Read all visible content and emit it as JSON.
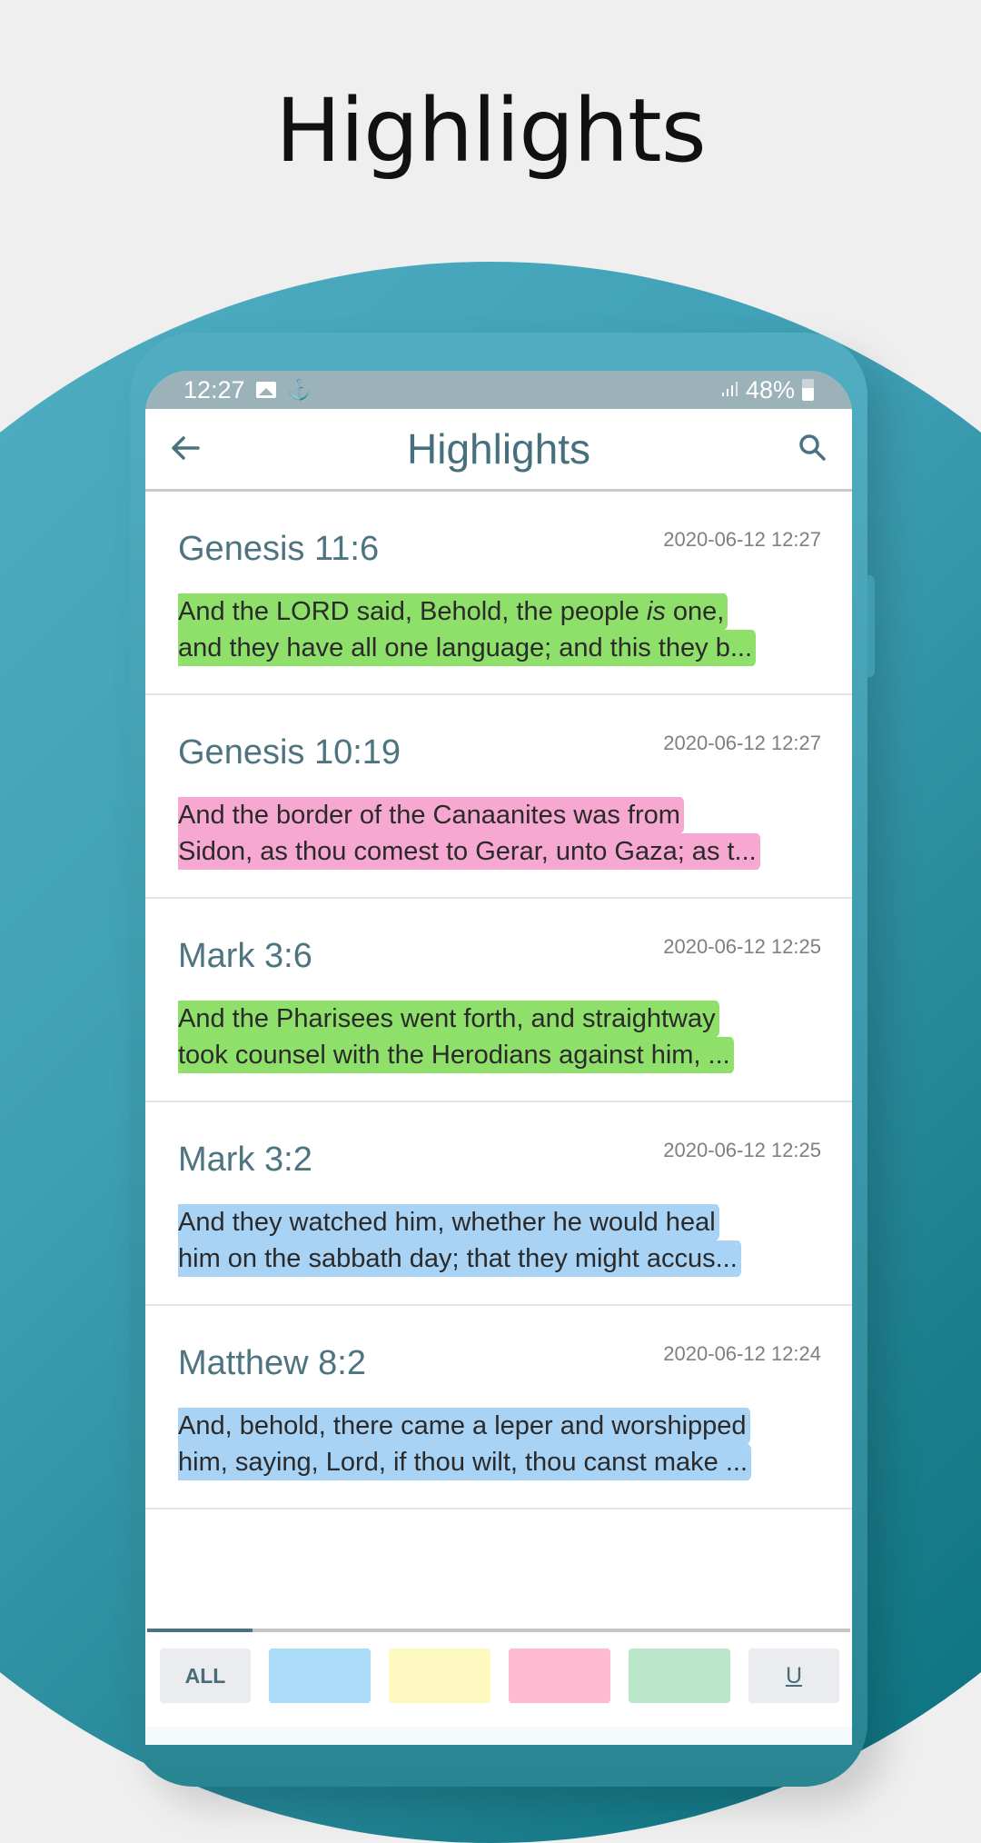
{
  "promo": {
    "title": "Highlights"
  },
  "status_bar": {
    "time": "12:27",
    "icons_left": [
      "image-icon",
      "notification-icon"
    ],
    "battery_percent": "48%",
    "icons_right": [
      "signal-icon",
      "battery-icon"
    ]
  },
  "toolbar": {
    "title": "Highlights",
    "back_icon": "arrow-left-icon",
    "search_icon": "search-icon"
  },
  "highlights": [
    {
      "reference": "Genesis 11:6",
      "date": "2020-06-12 12:27",
      "color": "#8fe06a",
      "line1_a": "And the LORD said, Behold, the people ",
      "line1_em": "is",
      "line1_b": " one,",
      "line2": "and they have all one language; and this they b..."
    },
    {
      "reference": "Genesis 10:19",
      "date": "2020-06-12 12:27",
      "color": "#f7a8d0",
      "line1_a": "And the border of the Canaanites was from",
      "line1_em": "",
      "line1_b": "",
      "line2": "Sidon, as thou comest to Gerar, unto Gaza; as t..."
    },
    {
      "reference": "Mark 3:6",
      "date": "2020-06-12 12:25",
      "color": "#8fe06a",
      "line1_a": "And the Pharisees went forth, and straightway",
      "line1_em": "",
      "line1_b": "",
      "line2": "took counsel with the Herodians against him, ..."
    },
    {
      "reference": "Mark 3:2",
      "date": "2020-06-12 12:25",
      "color": "#a9d3f5",
      "line1_a": "And they watched him, whether he would heal",
      "line1_em": "",
      "line1_b": "",
      "line2": "him on the sabbath day; that they might accus..."
    },
    {
      "reference": "Matthew 8:2",
      "date": "2020-06-12 12:24",
      "color": "#a9d3f5",
      "line1_a": "And, behold, there came a leper and worshipped",
      "line1_em": "",
      "line1_b": "",
      "line2": "him, saying, Lord, if thou wilt, thou canst make ..."
    }
  ],
  "filter_bar": {
    "active_index": 0,
    "chips": [
      {
        "label": "ALL",
        "type": "text",
        "color": "#eaecef"
      },
      {
        "label": "",
        "type": "color",
        "color": "#aadcf8",
        "name": "blue"
      },
      {
        "label": "",
        "type": "color",
        "color": "#fef8c1",
        "name": "yellow"
      },
      {
        "label": "",
        "type": "color",
        "color": "#fdbad1",
        "name": "pink"
      },
      {
        "label": "",
        "type": "color",
        "color": "#bbe6c9",
        "name": "green"
      },
      {
        "label": "U",
        "type": "text",
        "color": "#eaecef"
      }
    ]
  }
}
